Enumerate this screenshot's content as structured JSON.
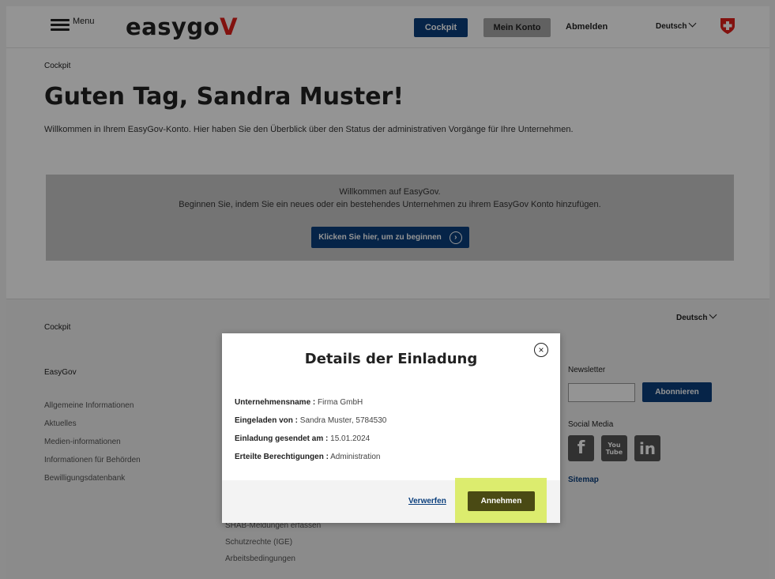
{
  "header": {
    "menu_label": "Menu",
    "logo_text": "easygo",
    "logo_mark": "V",
    "nav_cockpit": "Cockpit",
    "nav_konto": "Mein Konto",
    "nav_abmelden": "Abmelden",
    "language": "Deutsch",
    "swiss_icon": "swiss-cross-icon"
  },
  "main": {
    "breadcrumb": "Cockpit",
    "title": "Guten Tag, Sandra Muster!",
    "intro": "Willkommen in Ihrem EasyGov-Konto. Hier haben Sie den Überblick über den Status der administrativen Vorgänge für Ihre Unternehmen.",
    "welcome_line1": "Willkommen auf EasyGov.",
    "welcome_line2": "Beginnen Sie, indem Sie ein neues oder ein bestehendes Unternehmen zu ihrem EasyGov Konto hinzufügen.",
    "begin_button": "Klicken Sie hier, um zu beginnen"
  },
  "footer": {
    "cockpit": "Cockpit",
    "language": "Deutsch",
    "easygov": "EasyGov",
    "links": [
      "Allgemeine Informationen",
      "Aktuelles",
      "Medien-informationen",
      "Informationen für Behörden",
      "Bewilligungsdatenbank"
    ],
    "mid_links": [
      "SHAB-Meldungen erfassen",
      "Schutzrechte (IGE)",
      "Arbeitsbedingungen"
    ],
    "newsletter_label": "Newsletter",
    "newsletter_button": "Abonnieren",
    "social_label": "Social Media",
    "social": [
      "f",
      "You Tube",
      "in"
    ],
    "sitemap": "Sitemap"
  },
  "modal": {
    "title": "Details der Einladung",
    "rows": [
      {
        "label": "Unternehmensname :",
        "value": " Firma GmbH"
      },
      {
        "label": "Eingeladen von :",
        "value": " Sandra Muster, 5784530"
      },
      {
        "label": "Einladung gesendet am :",
        "value": " 15.01.2024"
      },
      {
        "label": "Erteilte Berechtigungen :",
        "value": " Administration"
      }
    ],
    "discard": "Verwerfen",
    "accept": "Annehmen",
    "highlight_color": "#d9eb5f"
  }
}
